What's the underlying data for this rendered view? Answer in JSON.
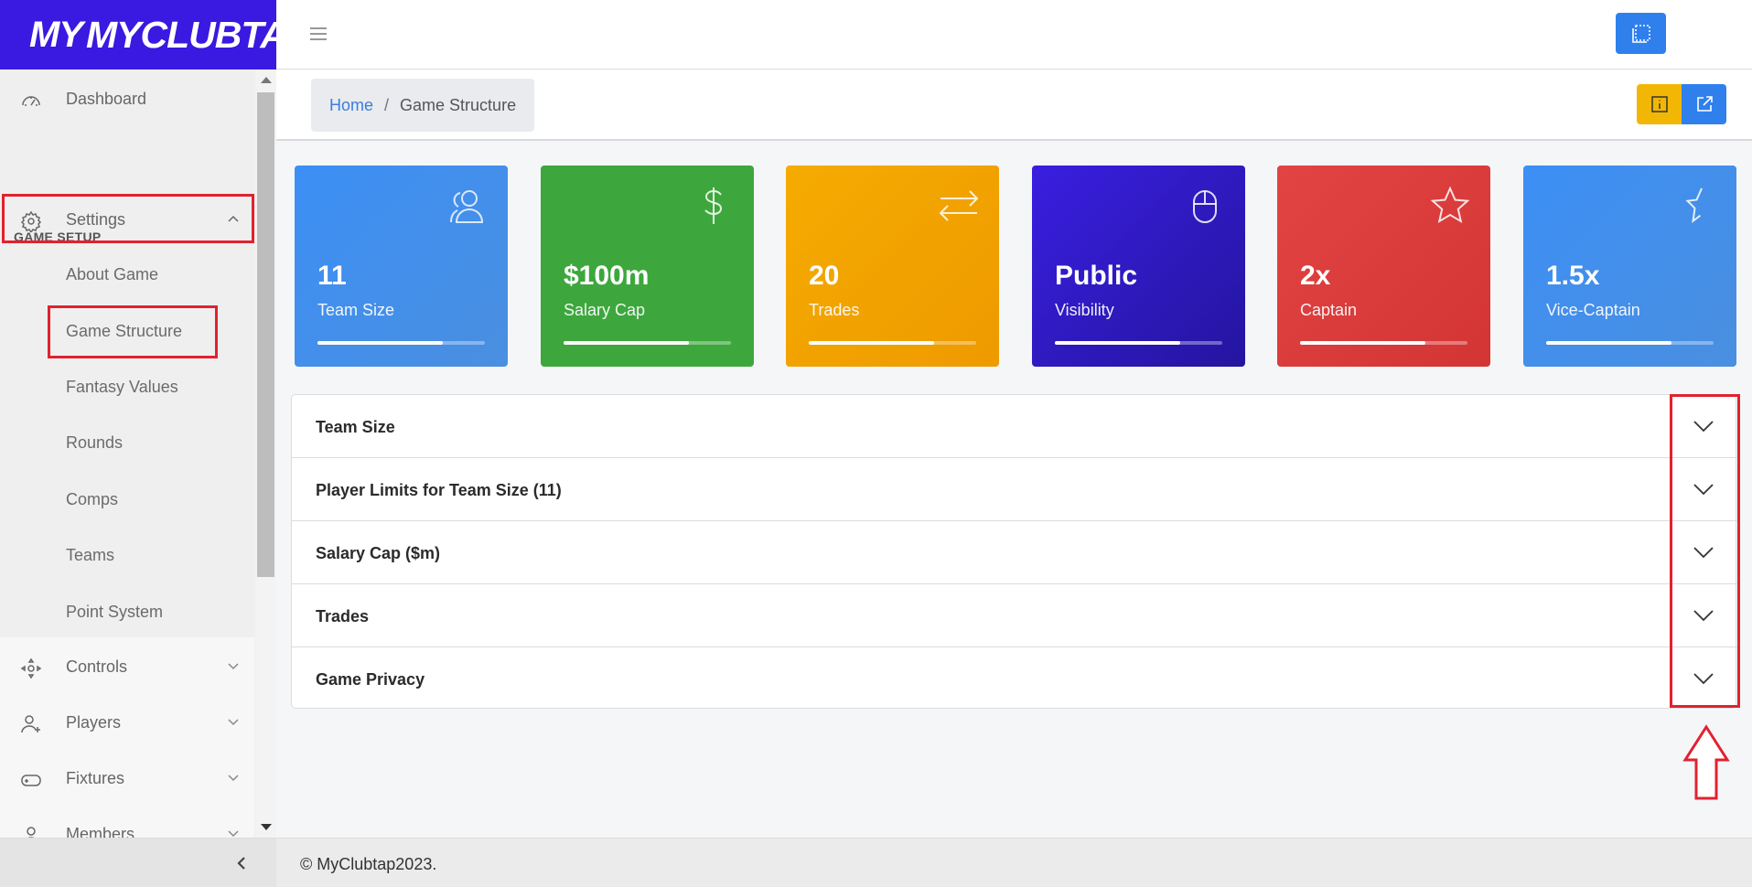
{
  "brand": {
    "name": "MYCLUBTAP",
    "mark": "MY"
  },
  "sidebar": {
    "dashboard": "Dashboard",
    "section_title": "GAME SETUP",
    "settings": "Settings",
    "settings_items": [
      "About Game",
      "Game Structure",
      "Fantasy Values",
      "Rounds",
      "Comps",
      "Teams",
      "Point System"
    ],
    "controls": "Controls",
    "players": "Players",
    "fixtures": "Fixtures",
    "members": "Members"
  },
  "breadcrumb": {
    "home": "Home",
    "separator": "/",
    "current": "Game Structure"
  },
  "cards": [
    {
      "value": "11",
      "label": "Team Size",
      "progress_percent": 75,
      "icon": "users-icon",
      "color": "#3d8ef0"
    },
    {
      "value": "$100m",
      "label": "Salary Cap",
      "progress_percent": 75,
      "icon": "dollar-icon",
      "color": "#3da73d"
    },
    {
      "value": "20",
      "label": "Trades",
      "progress_percent": 75,
      "icon": "swap-arrows-icon",
      "color": "#f0a500"
    },
    {
      "value": "Public",
      "label": "Visibility",
      "progress_percent": 75,
      "icon": "mouse-icon",
      "color": "#2a1ccf"
    },
    {
      "value": "2x",
      "label": "Captain",
      "progress_percent": 75,
      "icon": "star-icon",
      "color": "#dc3b3b"
    },
    {
      "value": "1.5x",
      "label": "Vice-Captain",
      "progress_percent": 75,
      "icon": "half-star-icon",
      "color": "#3d8ef0"
    }
  ],
  "accordion": [
    "Team Size",
    "Player Limits for Team Size (11)",
    "Salary Cap ($m)",
    "Trades",
    "Game Privacy"
  ],
  "footer": "© MyClubtap2023.",
  "colors": {
    "brand": "#3a19e0",
    "primary": "#2f80ed",
    "warning": "#f2b705",
    "highlight": "#e1222e"
  }
}
